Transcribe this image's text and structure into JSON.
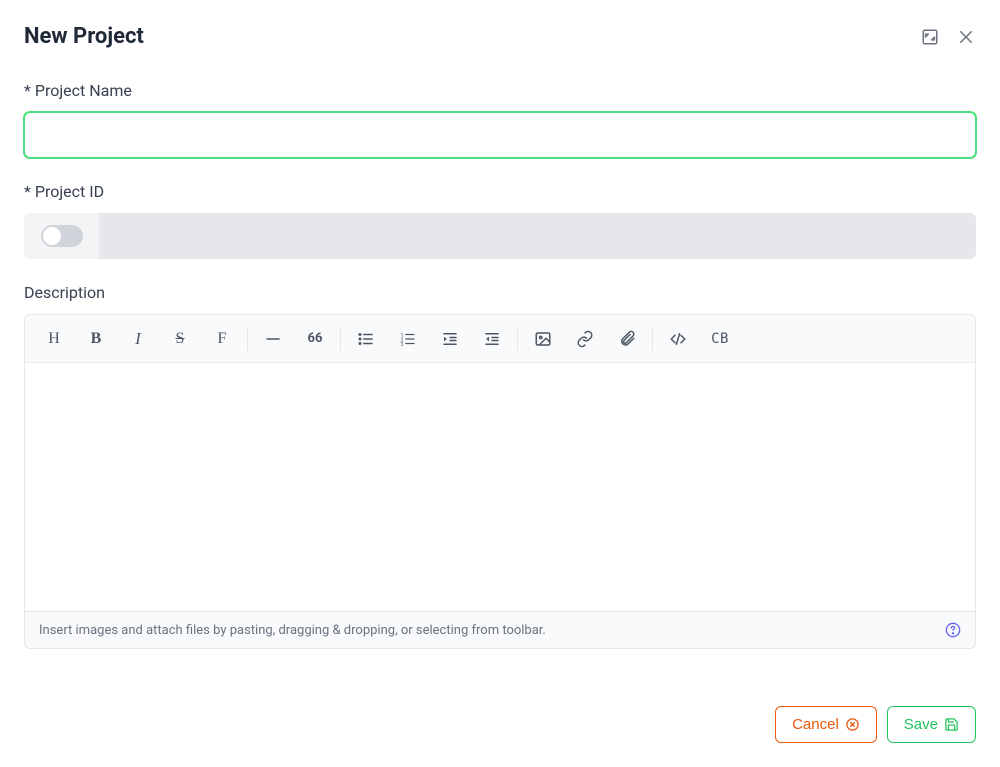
{
  "modal": {
    "title": "New Project"
  },
  "form": {
    "project_name": {
      "label": "* Project Name",
      "value": ""
    },
    "project_id": {
      "label": "* Project ID",
      "value": ""
    },
    "description": {
      "label": "Description",
      "footer_hint": "Insert images and attach files by pasting, dragging & dropping, or selecting from toolbar."
    }
  },
  "toolbar": {
    "heading": "H",
    "bold": "B",
    "italic": "I",
    "strike": "S",
    "font": "F",
    "quote": "66",
    "code_block": "CB"
  },
  "footer": {
    "cancel_label": "Cancel",
    "save_label": "Save"
  }
}
